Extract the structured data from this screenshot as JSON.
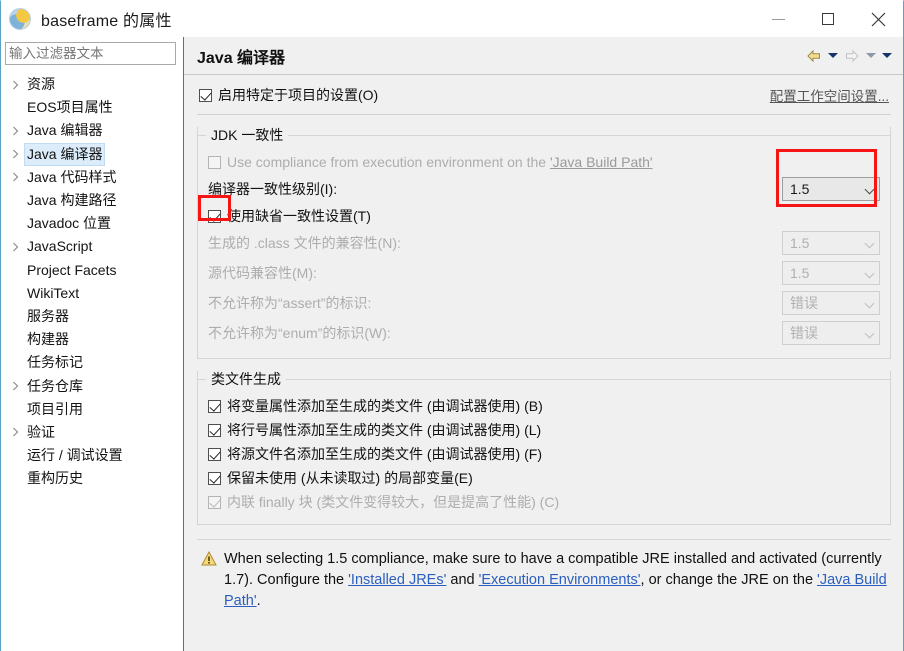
{
  "window": {
    "title": "baseframe 的属性",
    "app_icon": "eclipse-globe-icon",
    "minimize_label": "最小化",
    "maximize_label": "最大化",
    "close_label": "关闭"
  },
  "sidebar": {
    "filter": {
      "placeholder": "输入过滤器文本",
      "value": ""
    },
    "items": [
      {
        "label": "资源",
        "expandable": true,
        "selected": false
      },
      {
        "label": "EOS项目属性",
        "expandable": false,
        "selected": false
      },
      {
        "label": "Java 编辑器",
        "expandable": true,
        "selected": false
      },
      {
        "label": "Java 编译器",
        "expandable": true,
        "selected": true
      },
      {
        "label": "Java 代码样式",
        "expandable": true,
        "selected": false
      },
      {
        "label": "Java 构建路径",
        "expandable": false,
        "selected": false
      },
      {
        "label": "Javadoc 位置",
        "expandable": false,
        "selected": false
      },
      {
        "label": "JavaScript",
        "expandable": true,
        "selected": false
      },
      {
        "label": "Project Facets",
        "expandable": false,
        "selected": false
      },
      {
        "label": "WikiText",
        "expandable": false,
        "selected": false
      },
      {
        "label": "服务器",
        "expandable": false,
        "selected": false
      },
      {
        "label": "构建器",
        "expandable": false,
        "selected": false
      },
      {
        "label": "任务标记",
        "expandable": false,
        "selected": false
      },
      {
        "label": "任务仓库",
        "expandable": true,
        "selected": false
      },
      {
        "label": "项目引用",
        "expandable": false,
        "selected": false
      },
      {
        "label": "验证",
        "expandable": true,
        "selected": false
      },
      {
        "label": "运行 / 调试设置",
        "expandable": false,
        "selected": false
      },
      {
        "label": "重构历史",
        "expandable": false,
        "selected": false
      }
    ]
  },
  "page": {
    "title": "Java 编译器",
    "nav": {
      "back_icon": "back-arrow-icon",
      "back_menu_icon": "chevron-down-icon",
      "forward_icon": "forward-arrow-icon",
      "forward_menu_icon": "chevron-down-icon",
      "view_menu_icon": "chevron-down-icon"
    },
    "enable_project_settings": {
      "label": "启用特定于项目的设置(O)",
      "checked": true,
      "enabled": true
    },
    "configure_workspace_link": "配置工作空间设置..."
  },
  "jdk_compliance": {
    "group_title": "JDK 一致性",
    "use_execution_env": {
      "label_prefix": "Use compliance from execution environment on the ",
      "label_link": "'Java Build Path'",
      "checked": false,
      "enabled": false
    },
    "compliance_level": {
      "label": "编译器一致性级别(I):",
      "value": "1.5",
      "enabled": true,
      "highlighted": true
    },
    "use_default_compliance": {
      "label": "使用缺省一致性设置(T)",
      "checked": true,
      "enabled": true,
      "highlighted": true
    },
    "rows": [
      {
        "label": "生成的 .class 文件的兼容性(N):",
        "value": "1.5",
        "enabled": false
      },
      {
        "label": "源代码兼容性(M):",
        "value": "1.5",
        "enabled": false
      },
      {
        "label": "不允许称为“assert”的标识:",
        "value": "错误",
        "enabled": false
      },
      {
        "label": "不允许称为“enum”的标识(W):",
        "value": "错误",
        "enabled": false
      }
    ]
  },
  "class_file_generation": {
    "group_title": "类文件生成",
    "options": [
      {
        "label": "将变量属性添加至生成的类文件 (由调试器使用) (B)",
        "checked": true,
        "enabled": true
      },
      {
        "label": "将行号属性添加至生成的类文件 (由调试器使用) (L)",
        "checked": true,
        "enabled": true
      },
      {
        "label": "将源文件名添加至生成的类文件 (由调试器使用) (F)",
        "checked": true,
        "enabled": true
      },
      {
        "label": "保留未使用 (从未读取过) 的局部变量(E)",
        "checked": true,
        "enabled": true
      },
      {
        "label": "内联 finally 块 (类文件变得较大，但是提高了性能) (C)",
        "checked": true,
        "enabled": false
      }
    ]
  },
  "warning": {
    "icon": "warning-triangle-icon",
    "text_part1": "When selecting 1.5 compliance, make sure to have a compatible JRE installed and activated (currently 1.7). Configure the ",
    "link1": "'Installed JREs'",
    "text_part2": " and ",
    "link2": "'Execution Environments'",
    "text_part3": ", or change the JRE on the ",
    "link3": "'Java Build Path'",
    "text_part4": "."
  },
  "annotations": {
    "combo_highlight_color": "#f71414",
    "checkbox_highlight_color": "#f71414"
  }
}
